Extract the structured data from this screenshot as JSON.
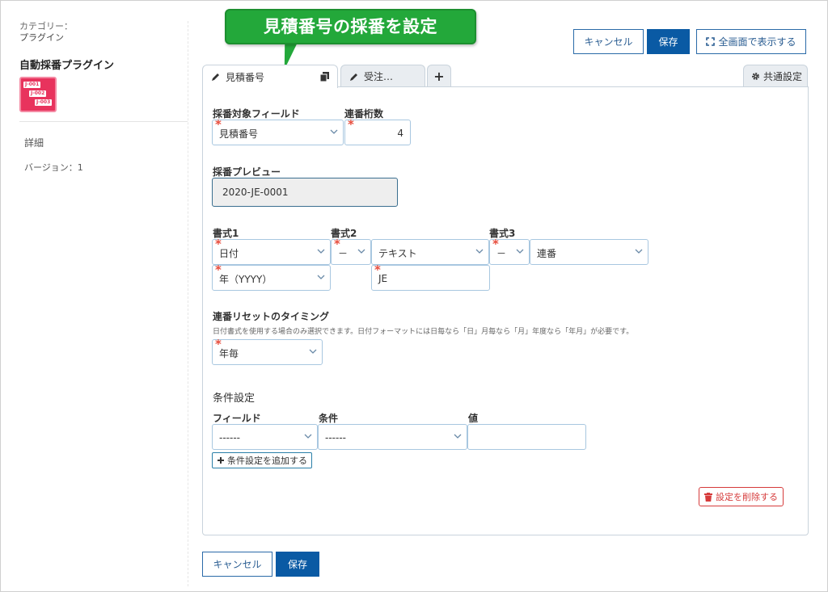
{
  "sidebar": {
    "category_label": "カテゴリー：",
    "category_value": "プラグイン",
    "plugin_name": "自動採番プラグイン",
    "icon_tags": [
      "J-001",
      "J-002",
      "J-003"
    ],
    "links": [
      "詳細",
      "バージョン：1"
    ]
  },
  "callout": {
    "text": "見積番号の採番を設定"
  },
  "toolbar": {
    "cancel_label": "キャンセル",
    "save_label": "保存",
    "fullscreen_label": "全画面で表示する"
  },
  "tabs": {
    "items": [
      {
        "label": "見積番号"
      },
      {
        "label": "受注…"
      },
      {
        "label": "+"
      }
    ],
    "common_settings_label": "共通設定"
  },
  "form": {
    "target_field_label": "採番対象フィールド",
    "target_field_value": "見積番号",
    "digits_label": "連番桁数",
    "digits_value": "4",
    "preview_label": "採番プレビュー",
    "preview_value": "2020-JE-0001",
    "format1_label": "書式1",
    "format1_type": "日付",
    "format1_sub": "年（YYYY）",
    "format2_label": "書式2",
    "format2_sep": "－",
    "format2_type": "テキスト",
    "format2_text": "JE",
    "format3_label": "書式3",
    "format3_sep": "－",
    "format3_type": "連番",
    "reset_label": "連番リセットのタイミング",
    "reset_hint": "日付書式を使用する場合のみ選択できます。日付フォーマットには日毎なら「日」月毎なら「月」年度なら「年月」が必要です。",
    "reset_value": "年毎"
  },
  "conditions": {
    "title": "条件設定",
    "field_label": "フィールド",
    "cond_label": "条件",
    "value_label": "値",
    "field_value": "------",
    "cond_value": "------",
    "value_value": "",
    "add_label": "条件設定を追加する",
    "delete_label": "設定を削除する"
  },
  "footer": {
    "cancel_label": "キャンセル",
    "save_label": "保存"
  },
  "colors": {
    "primary": "#0a5aa4",
    "callout": "#23a83a",
    "required": "#e74c3c",
    "danger": "#d63b3b"
  }
}
